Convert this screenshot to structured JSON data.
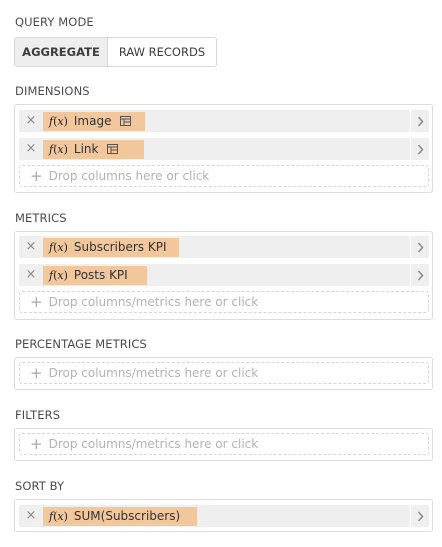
{
  "query_mode": {
    "label": "QUERY MODE",
    "options": [
      "AGGREGATE",
      "RAW RECORDS"
    ],
    "selected": "AGGREGATE"
  },
  "dimensions": {
    "label": "DIMENSIONS",
    "items": [
      {
        "label": "Image",
        "fx": "f(x)",
        "has_table_icon": true
      },
      {
        "label": "Link",
        "fx": "f(x)",
        "has_table_icon": true
      }
    ],
    "drop_placeholder": "Drop columns here or click"
  },
  "metrics": {
    "label": "METRICS",
    "items": [
      {
        "label": "Subscribers KPI",
        "fx": "f(x)"
      },
      {
        "label": "Posts KPI",
        "fx": "f(x)"
      }
    ],
    "drop_placeholder": "Drop columns/metrics here or click"
  },
  "percentage_metrics": {
    "label": "PERCENTAGE METRICS",
    "drop_placeholder": "Drop columns/metrics here or click"
  },
  "filters": {
    "label": "FILTERS",
    "drop_placeholder": "Drop columns/metrics here or click"
  },
  "sort_by": {
    "label": "SORT BY",
    "items": [
      {
        "label": "SUM(Subscribers)",
        "fx": "f(x)"
      }
    ]
  },
  "icons": {
    "remove": "close-icon",
    "expand": "chevron-right-icon",
    "add": "plus-icon",
    "table": "table-icon"
  },
  "colors": {
    "pill_bg": "#efefef",
    "label_highlight": "#f2c79c",
    "active_toggle_bg": "#eeeeee",
    "border": "#dcdcdc",
    "placeholder": "#b3b3b3"
  }
}
